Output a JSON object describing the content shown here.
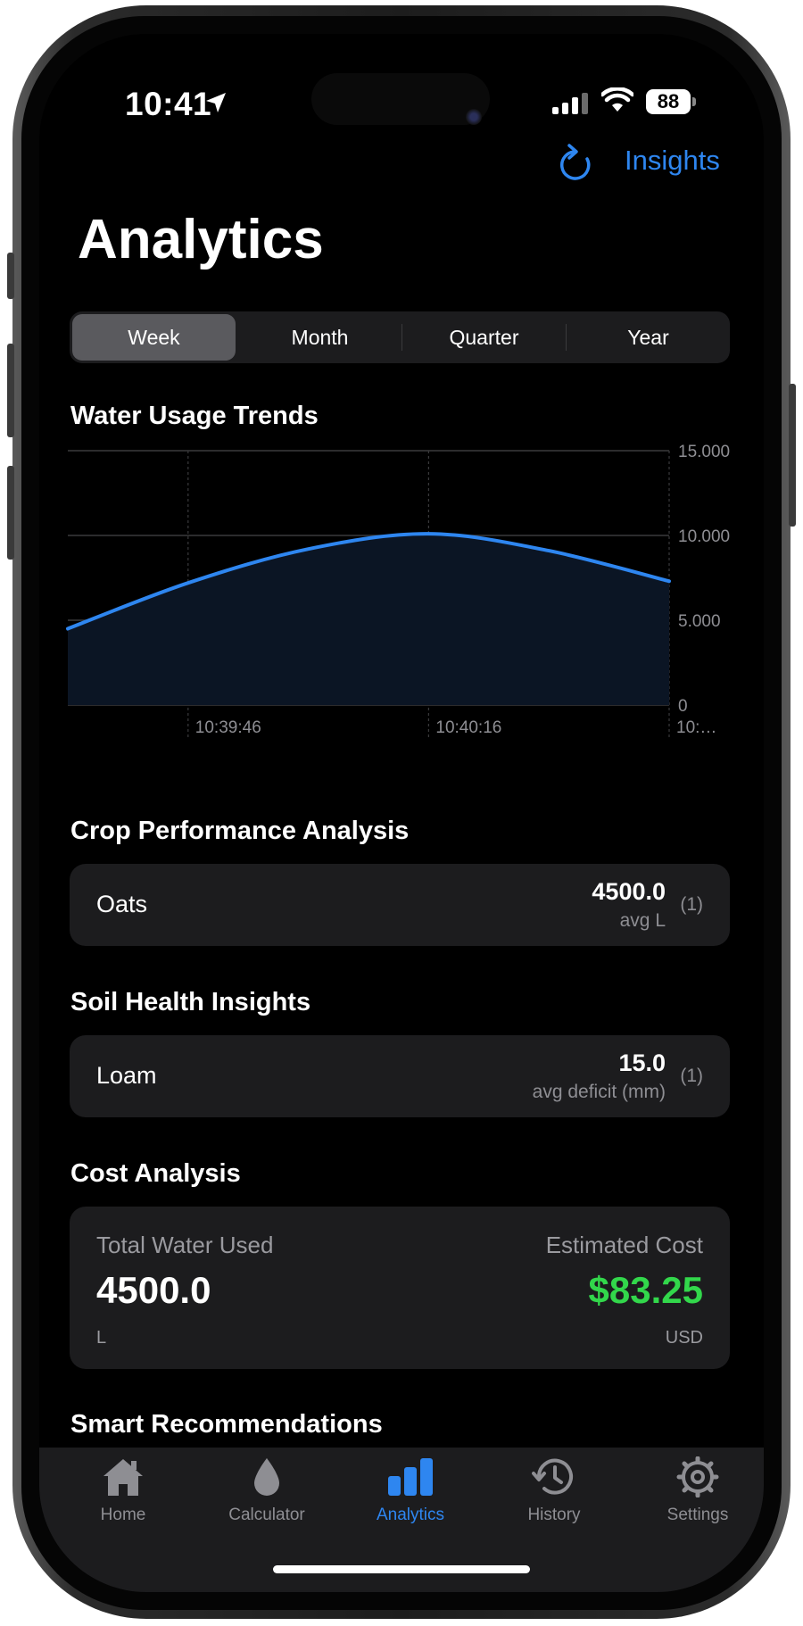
{
  "status": {
    "time": "10:41",
    "battery": "88"
  },
  "nav": {
    "insights_label": "Insights",
    "title": "Analytics"
  },
  "periods": {
    "active": "Week",
    "items": [
      "Week",
      "Month",
      "Quarter",
      "Year"
    ]
  },
  "chart_section": {
    "title": "Water Usage Trends"
  },
  "chart_data": {
    "type": "area",
    "title": "Water Usage Trends",
    "x": [
      "10:39:31",
      "10:39:46",
      "10:40:01",
      "10:40:16",
      "10:40:31",
      "10:40:46"
    ],
    "values": [
      4500,
      7200,
      9200,
      10100,
      9100,
      7300
    ],
    "x_tick_labels": [
      "10:39:46",
      "10:40:16",
      "10:…"
    ],
    "y_tick_labels": [
      "0",
      "5.000",
      "10.000",
      "15.000"
    ],
    "ylim": [
      0,
      15000
    ],
    "y_axis_position": "right",
    "grid": true,
    "line_color": "#2e86f0"
  },
  "crop": {
    "title": "Crop Performance Analysis",
    "rows": [
      {
        "name": "Oats",
        "value": "4500.0",
        "unit": "avg L",
        "count": "(1)"
      }
    ]
  },
  "soil": {
    "title": "Soil Health Insights",
    "rows": [
      {
        "name": "Loam",
        "value": "15.0",
        "unit": "avg deficit (mm)",
        "count": "(1)"
      }
    ]
  },
  "cost": {
    "title": "Cost Analysis",
    "total_label": "Total Water Used",
    "total_value": "4500.0",
    "total_unit": "L",
    "est_label": "Estimated Cost",
    "est_value": "$83.25",
    "est_unit": "USD",
    "est_color": "#32d74b"
  },
  "recommendations": {
    "title": "Smart Recommendations"
  },
  "tabs": [
    {
      "label": "Home",
      "icon": "house-icon"
    },
    {
      "label": "Calculator",
      "icon": "drop-icon"
    },
    {
      "label": "Analytics",
      "icon": "chart-bar-icon",
      "active": true
    },
    {
      "label": "History",
      "icon": "clock-history-icon"
    },
    {
      "label": "Settings",
      "icon": "gear-icon"
    }
  ]
}
